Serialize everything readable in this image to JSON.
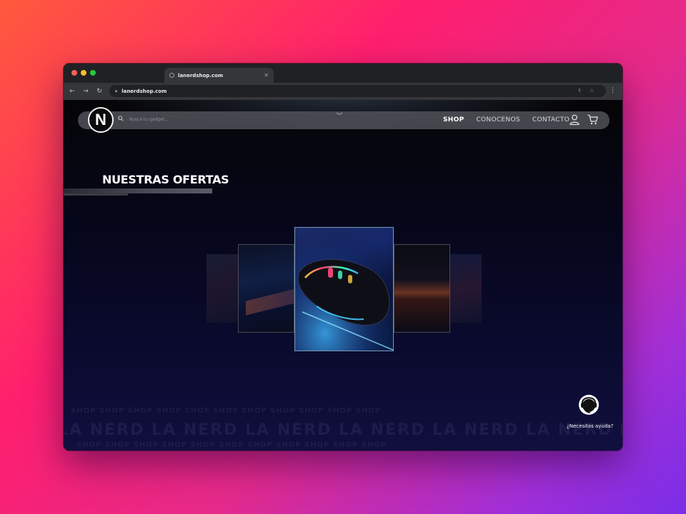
{
  "browser": {
    "tab_title": "lanerdshop.com",
    "url": "lanerdshop.com",
    "traffic_colors": [
      "#ff5f57",
      "#febc2e",
      "#28c840"
    ]
  },
  "header": {
    "logo_letter": "N",
    "search_placeholder": "Buscá tu gadget...",
    "nav": [
      "SHOP",
      "CONOCENOS",
      "CONTACTO"
    ]
  },
  "offers": {
    "title": "NUESTRAS OFERTAS",
    "slides": [
      "card-far-left",
      "card-left",
      "card-center",
      "card-right",
      "card-far-right"
    ]
  },
  "watermark": {
    "big": "LA NERD   LA NERD   LA NERD   LA NERD   LA NERD   LA NERD   LA NERD",
    "small": "SHOP   SHOP   SHOP   SHOP   SHOP   SHOP   SHOP   SHOP   SHOP   SHOP   SHOP"
  },
  "help": {
    "label": "¿Necesitas ayuda?"
  }
}
